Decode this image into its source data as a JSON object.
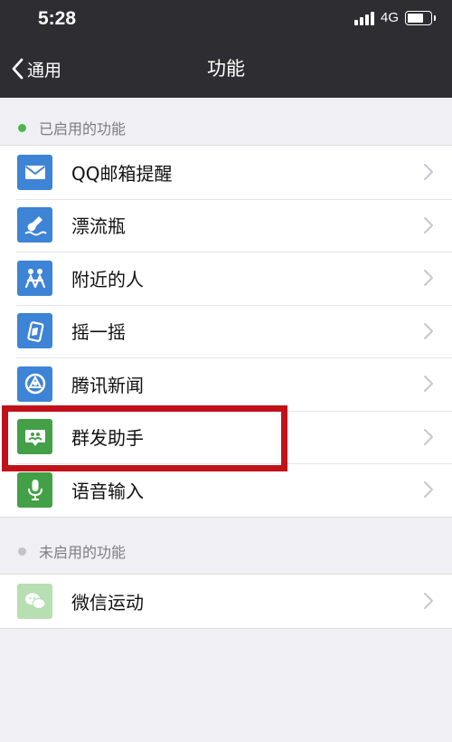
{
  "status_bar": {
    "time": "5:28",
    "network": "4G"
  },
  "nav": {
    "back_label": "通用",
    "title": "功能"
  },
  "enabled_section": {
    "header": "已启用的功能",
    "dot_color": "#4cb84a",
    "items": [
      {
        "label": "QQ邮箱提醒",
        "icon": "mail-icon",
        "color": "#3d83d6"
      },
      {
        "label": "漂流瓶",
        "icon": "drift-bottle-icon",
        "color": "#3d83d6"
      },
      {
        "label": "附近的人",
        "icon": "people-nearby-icon",
        "color": "#3d83d6"
      },
      {
        "label": "摇一摇",
        "icon": "shake-icon",
        "color": "#3d83d6"
      },
      {
        "label": "腾讯新闻",
        "icon": "news-icon",
        "color": "#3d83d6"
      },
      {
        "label": "群发助手",
        "icon": "broadcast-icon",
        "color": "#43a047"
      },
      {
        "label": "语音输入",
        "icon": "microphone-icon",
        "color": "#43a047"
      }
    ]
  },
  "disabled_section": {
    "header": "未启用的功能",
    "dot_color": "#c4c4c8",
    "items": [
      {
        "label": "微信运动",
        "icon": "werun-icon",
        "color": "#b7dfb1"
      }
    ]
  },
  "highlight_color": "#c1121a"
}
